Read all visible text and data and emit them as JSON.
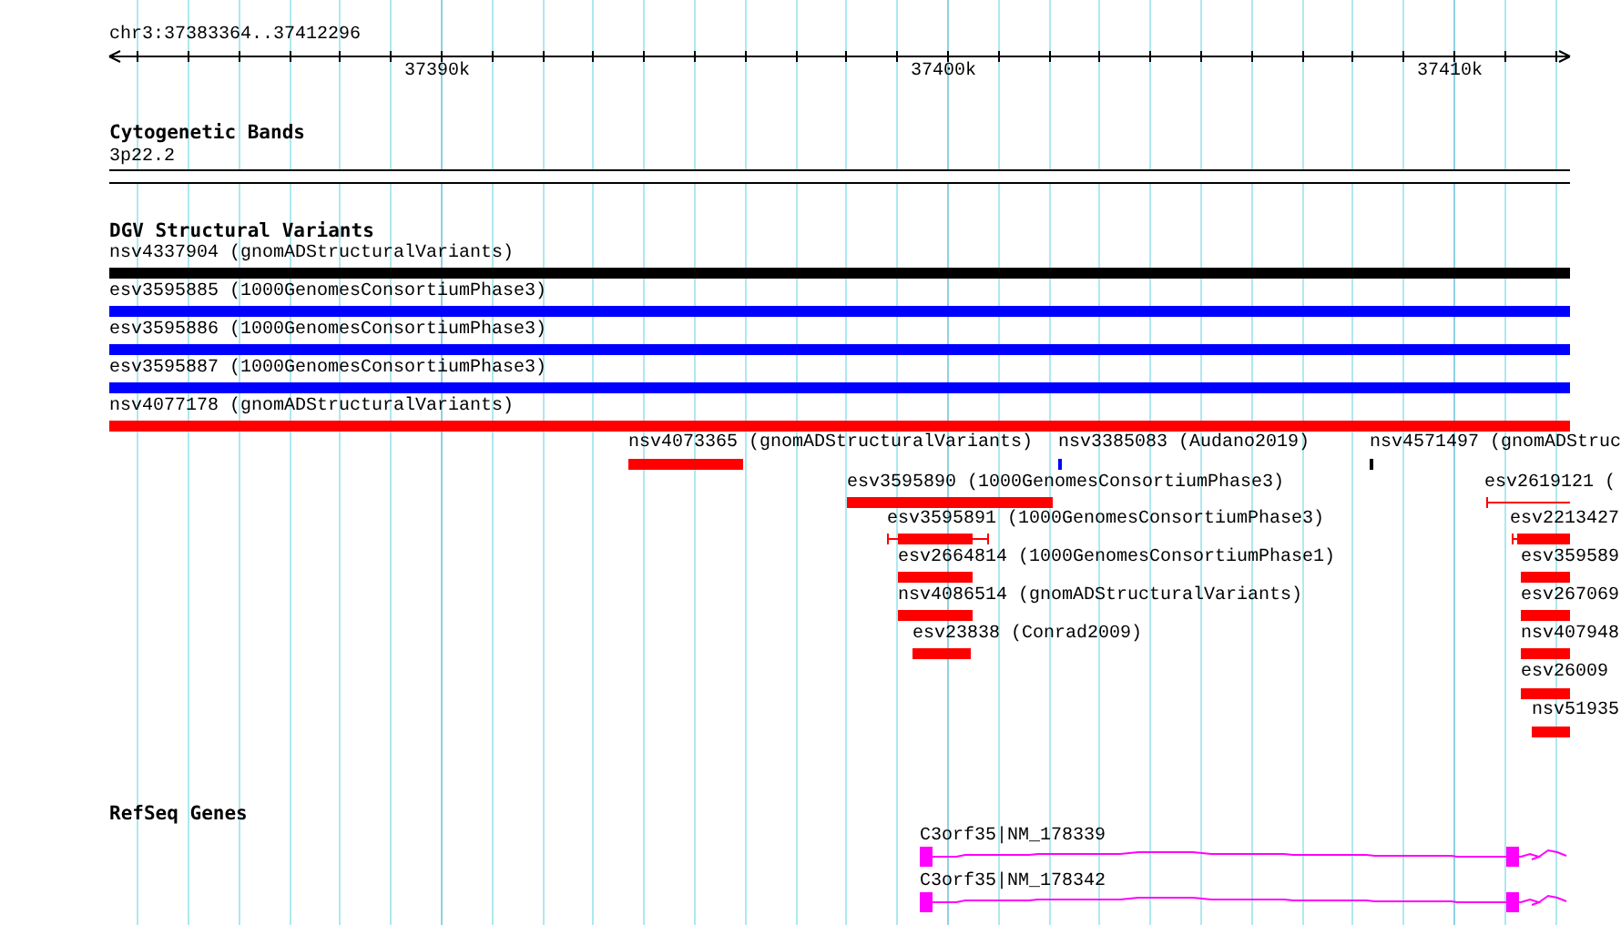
{
  "ruler": {
    "location": "chr3:37383364..37412296",
    "ticks": [
      "37390k",
      "37400k",
      "37410k"
    ]
  },
  "tracks": [
    {
      "kind": "cytoband",
      "title": "Cytogenetic Bands",
      "band": "3p22.2"
    },
    {
      "kind": "variants",
      "title": "DGV Structural Variants",
      "features": [
        {
          "label": "nsv4337904 (gnomADStructuralVariants)",
          "color": "#000000"
        },
        {
          "label": "esv3595885 (1000GenomesConsortiumPhase3)",
          "color": "#0000ff"
        },
        {
          "label": "esv3595886 (1000GenomesConsortiumPhase3)",
          "color": "#0000ff"
        },
        {
          "label": "esv3595887 (1000GenomesConsortiumPhase3)",
          "color": "#0000ff"
        },
        {
          "label": "nsv4077178 (gnomADStructuralVariants)",
          "color": "#ff0000"
        },
        {
          "label": "nsv4073365 (gnomADStructuralVariants)",
          "color": "#ff0000"
        },
        {
          "label": "nsv3385083 (Audano2019)",
          "color": "#0000ff"
        },
        {
          "label": "nsv4571497 (gnomADStruc",
          "color": "#000000"
        },
        {
          "label": "esv3595890 (1000GenomesConsortiumPhase3)",
          "color": "#ff0000"
        },
        {
          "label": "esv2619121 (",
          "color": "#ff0000"
        },
        {
          "label": "esv3595891 (1000GenomesConsortiumPhase3)",
          "color": "#ff0000"
        },
        {
          "label": "esv2213427",
          "color": "#ff0000"
        },
        {
          "label": "esv2664814 (1000GenomesConsortiumPhase1)",
          "color": "#ff0000"
        },
        {
          "label": "esv359589",
          "color": "#ff0000"
        },
        {
          "label": "nsv4086514 (gnomADStructuralVariants)",
          "color": "#ff0000"
        },
        {
          "label": "esv267069",
          "color": "#ff0000"
        },
        {
          "label": "esv23838 (Conrad2009)",
          "color": "#ff0000"
        },
        {
          "label": "nsv407948",
          "color": "#ff0000"
        },
        {
          "label": "esv26009",
          "color": "#ff0000"
        },
        {
          "label": "nsv51935",
          "color": "#ff0000"
        }
      ]
    },
    {
      "kind": "genes",
      "title": "RefSeq Genes",
      "transcripts": [
        {
          "label": "C3orf35|NM_178339",
          "color": "#ff00ff"
        },
        {
          "label": "C3orf35|NM_178342",
          "color": "#ff00ff"
        }
      ]
    }
  ]
}
